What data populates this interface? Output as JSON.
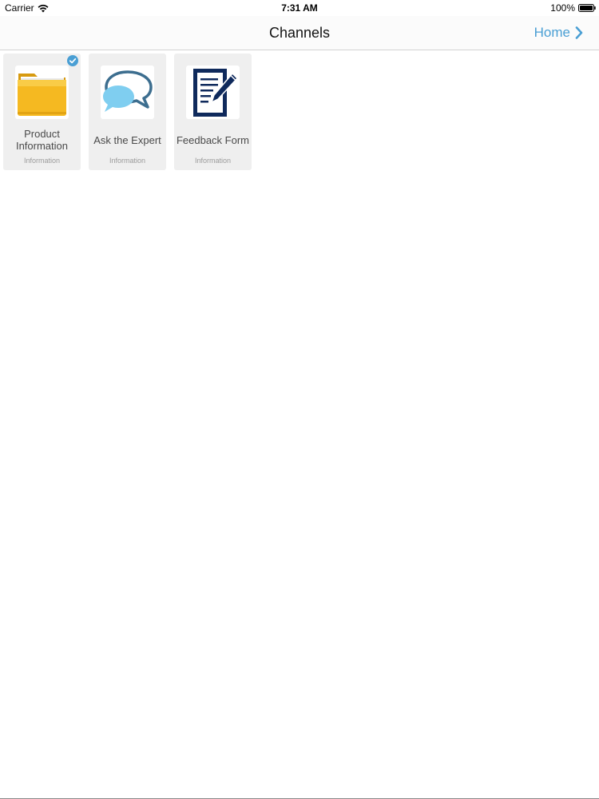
{
  "status_bar": {
    "carrier": "Carrier",
    "time": "7:31 AM",
    "battery": "100%"
  },
  "nav": {
    "title": "Channels",
    "home_label": "Home"
  },
  "tiles": [
    {
      "title": "Product Information",
      "subtitle": "Information",
      "icon": "folder-icon",
      "selected": true
    },
    {
      "title": "Ask the Expert",
      "subtitle": "Information",
      "icon": "speech-bubbles-icon",
      "selected": false
    },
    {
      "title": "Feedback Form",
      "subtitle": "Information",
      "icon": "form-pen-icon",
      "selected": false
    }
  ],
  "colors": {
    "accent": "#4a9fd4",
    "tile_background": "#efefef",
    "folder": "#f4b400",
    "bubble_light": "#7fcef0",
    "bubble_dark": "#3d6e8f",
    "form_dark": "#0f2a5c"
  }
}
